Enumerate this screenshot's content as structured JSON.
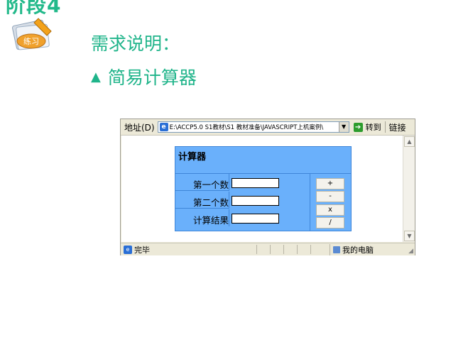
{
  "slide": {
    "title": "阶段4",
    "badge_text": "练习",
    "requirement_label": "需求说明：",
    "bullet_symbol": "▲",
    "bullet_text": "简易计算器"
  },
  "browser": {
    "address_label": "地址(D)",
    "address_value": "E:\\ACCP5.0 S1教材\\S1 教材准备\\JAVASCRIPT上机案例\\",
    "go_label": "转到",
    "links_label": "链接",
    "status_text": "完毕",
    "zone_text": "我的电脑"
  },
  "calculator": {
    "title": "计算器",
    "rows": [
      {
        "label": "第一个数",
        "value": ""
      },
      {
        "label": "第二个数",
        "value": ""
      },
      {
        "label": "计算结果",
        "value": ""
      }
    ],
    "operators": [
      "+",
      "-",
      "x",
      "/"
    ]
  }
}
